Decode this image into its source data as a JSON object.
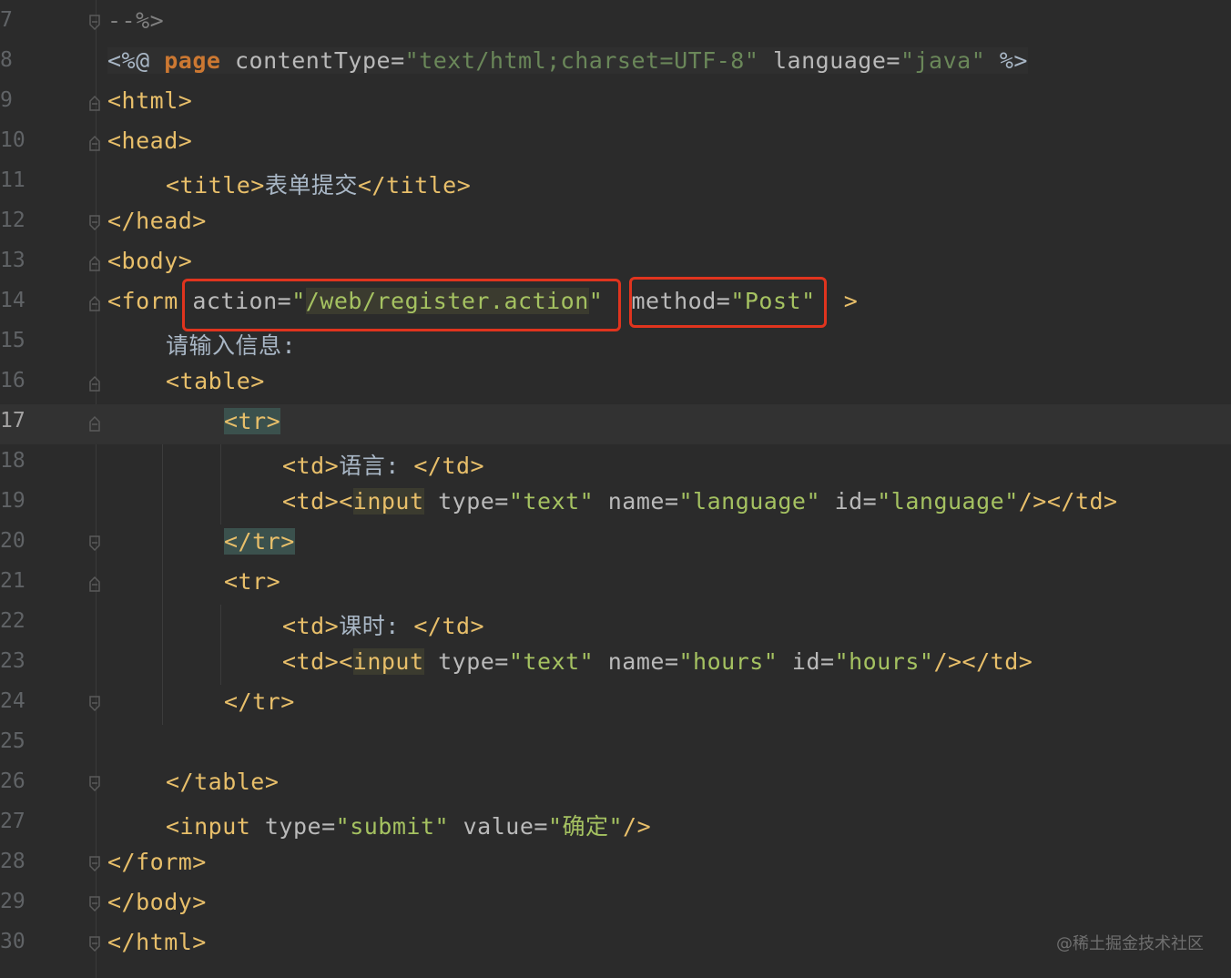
{
  "editor": {
    "lines": [
      {
        "num": "7"
      },
      {
        "num": "8"
      },
      {
        "num": "9"
      },
      {
        "num": "10"
      },
      {
        "num": "11"
      },
      {
        "num": "12"
      },
      {
        "num": "13"
      },
      {
        "num": "14"
      },
      {
        "num": "15"
      },
      {
        "num": "16"
      },
      {
        "num": "17"
      },
      {
        "num": "18"
      },
      {
        "num": "19"
      },
      {
        "num": "20"
      },
      {
        "num": "21"
      },
      {
        "num": "22"
      },
      {
        "num": "23"
      },
      {
        "num": "24"
      },
      {
        "num": "25"
      },
      {
        "num": "26"
      },
      {
        "num": "27"
      },
      {
        "num": "28"
      },
      {
        "num": "29"
      },
      {
        "num": "30"
      }
    ],
    "current_line": "17",
    "tokens": {
      "l7": "--%>",
      "l8_open": "<%@",
      "l8_page": "page",
      "l8_ct": "contentType=",
      "l8_ct_val": "\"text/html;charset=UTF-8\"",
      "l8_lang": "language=",
      "l8_lang_val": "\"java\"",
      "l8_close": "%>",
      "l9": "<html>",
      "l10": "<head>",
      "l11_open": "<title>",
      "l11_text": "表单提交",
      "l11_close": "</title>",
      "l12": "</head>",
      "l13": "<body>",
      "l14_open": "<form",
      "l14_action": "action=",
      "l14_q1": "\"",
      "l14_action_val": "/web/register.action",
      "l14_q2": "\"",
      "l14_method": "method=",
      "l14_method_val": "\"Post\"",
      "l14_close": ">",
      "l15_text": "请输入信息:",
      "l16": "<table>",
      "l17": "<tr>",
      "l18_open": "<td>",
      "l18_text": "语言:",
      "l18_close": "</td>",
      "l19_td": "<td><",
      "l19_input": "input",
      "l19_type": "type=",
      "l19_type_val": "\"text\"",
      "l19_name": "name=",
      "l19_name_val": "\"language\"",
      "l19_id": "id=",
      "l19_id_val": "\"language\"",
      "l19_close": "/></td>",
      "l20": "</tr>",
      "l21": "<tr>",
      "l22_open": "<td>",
      "l22_text": "课时:",
      "l22_close": "</td>",
      "l23_td": "<td><",
      "l23_input": "input",
      "l23_type": "type=",
      "l23_type_val": "\"text\"",
      "l23_name": "name=",
      "l23_name_val": "\"hours\"",
      "l23_id": "id=",
      "l23_id_val": "\"hours\"",
      "l23_close": "/></td>",
      "l24": "</tr>",
      "l26": "</table>",
      "l27_open": "<input",
      "l27_type": "type=",
      "l27_type_val": "\"submit\"",
      "l27_value": "value=",
      "l27_value_val": "\"确定\"",
      "l27_close": "/>",
      "l28": "</form>",
      "l29": "</body>",
      "l30": "</html>"
    },
    "highlight_color": "#e0341e"
  },
  "watermark": "@稀土掘金技术社区"
}
